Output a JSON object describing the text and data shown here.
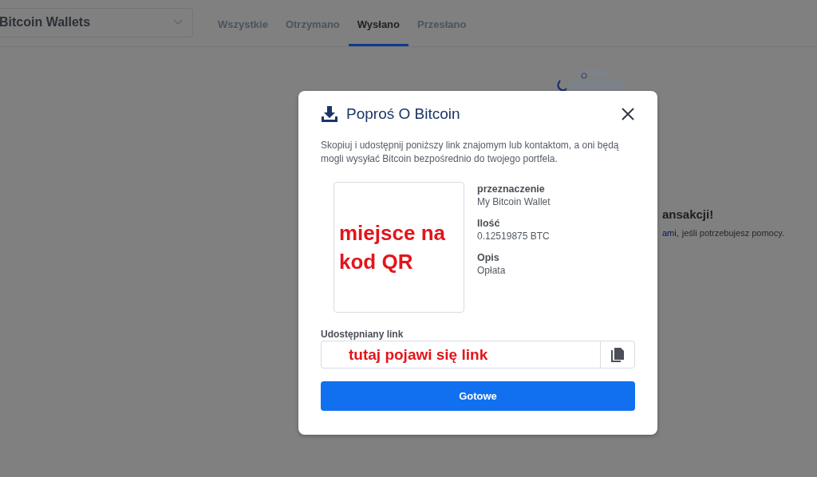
{
  "wallet_selector": {
    "value": "Bitcoin Wallets"
  },
  "tabs": [
    {
      "label": "Wszystkie",
      "selected": false
    },
    {
      "label": "Otrzymano",
      "selected": false
    },
    {
      "label": "Wysłano",
      "selected": true
    },
    {
      "label": "Przesłano",
      "selected": false
    }
  ],
  "empty_state": {
    "heading": "ansakcji!",
    "link": "ami,",
    "text": "jeśli potrzebujesz pomocy."
  },
  "dialog": {
    "title": "Poproś O Bitcoin",
    "description": "Skopiuj i udostępnij poniższy link znajomym lub kontaktom, a oni będą mogli wysyłać Bitcoin bezpośrednio do twojego portfela.",
    "qr_placeholder": "miejsce na kod QR",
    "details": [
      {
        "label": "przeznaczenie",
        "value": "My Bitcoin Wallet"
      },
      {
        "label": "Ilość",
        "value": "0.12519875 BTC"
      },
      {
        "label": "Opis",
        "value": "Opłata"
      }
    ],
    "link_label": "Udostępniany link",
    "link_value": "tutaj pojawi się link",
    "done_button": "Gotowe"
  }
}
